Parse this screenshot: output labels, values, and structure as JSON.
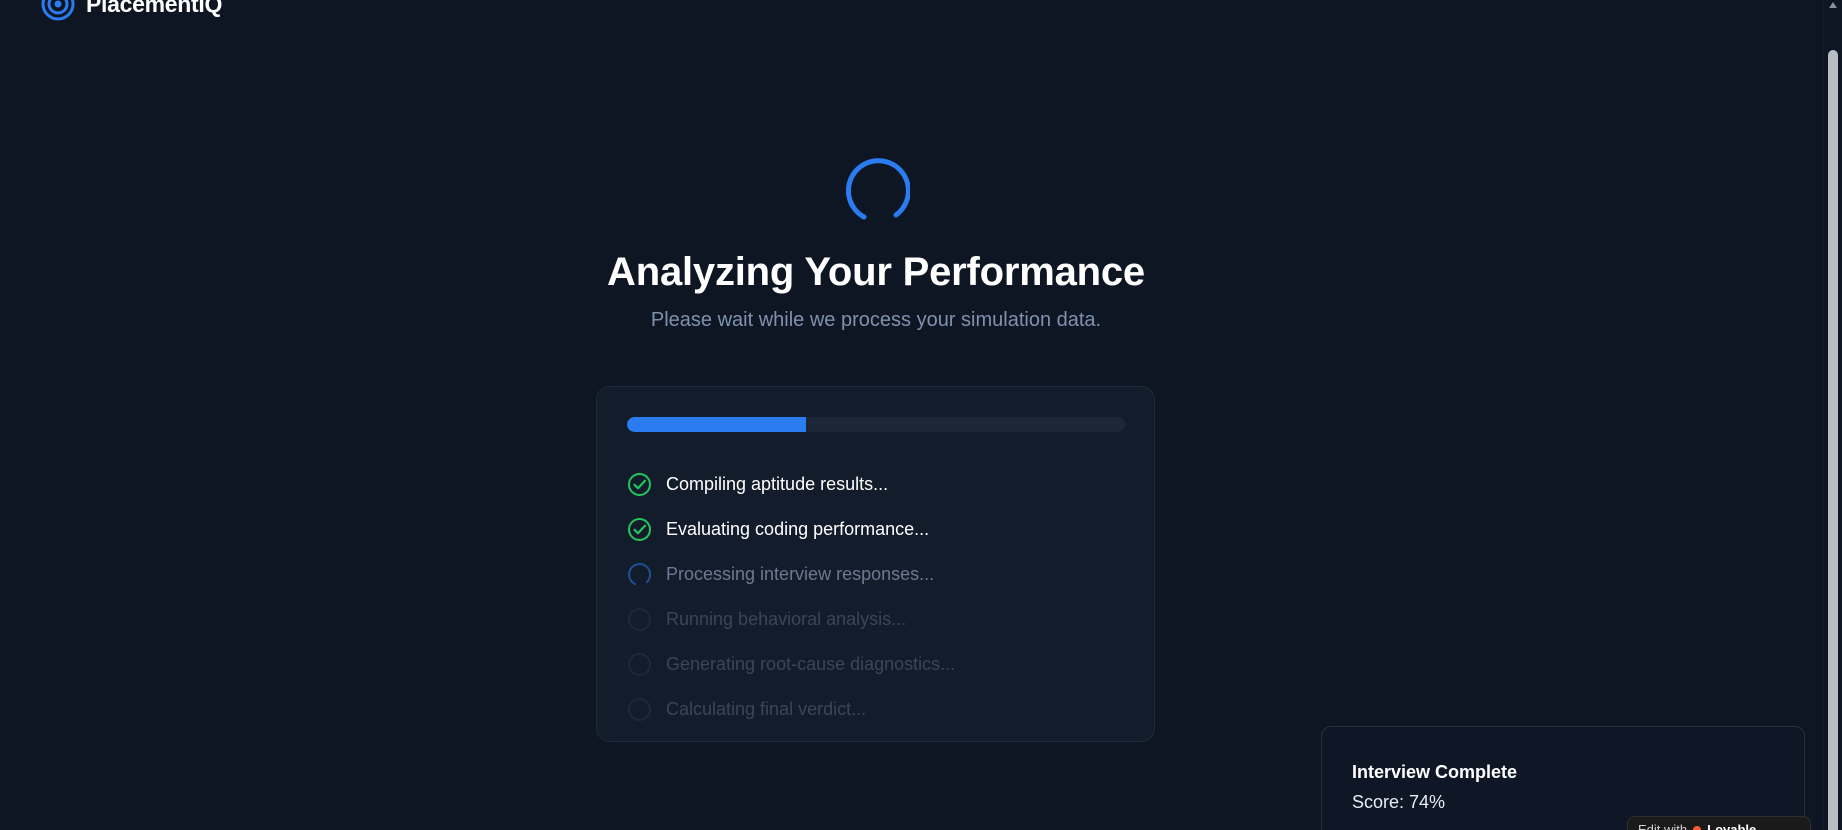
{
  "app": {
    "name": "PlacementIQ"
  },
  "analysis": {
    "title": "Analyzing Your Performance",
    "subtitle": "Please wait while we process your simulation data.",
    "progress": 0.36,
    "steps": [
      {
        "label": "Compiling aptitude results...",
        "status": "done"
      },
      {
        "label": "Evaluating coding performance...",
        "status": "done"
      },
      {
        "label": "Processing interview responses...",
        "status": "active"
      },
      {
        "label": "Running behavioral analysis...",
        "status": "pending"
      },
      {
        "label": "Generating root-cause diagnostics...",
        "status": "pending"
      },
      {
        "label": "Calculating final verdict...",
        "status": "pending"
      }
    ]
  },
  "toast": {
    "title": "Interview Complete",
    "score": "Score: 74%"
  },
  "edit_badge": {
    "prefix": "Edit with",
    "brand": "Lovable"
  },
  "colors": {
    "background": "#0e1624",
    "accent": "#2a7cf0",
    "success": "#22c55e",
    "muted": "#7f92ad"
  },
  "icons": {
    "logo": "target-icon",
    "done": "check-circle-icon",
    "active": "spinner-icon",
    "pending": "empty-circle-icon"
  }
}
